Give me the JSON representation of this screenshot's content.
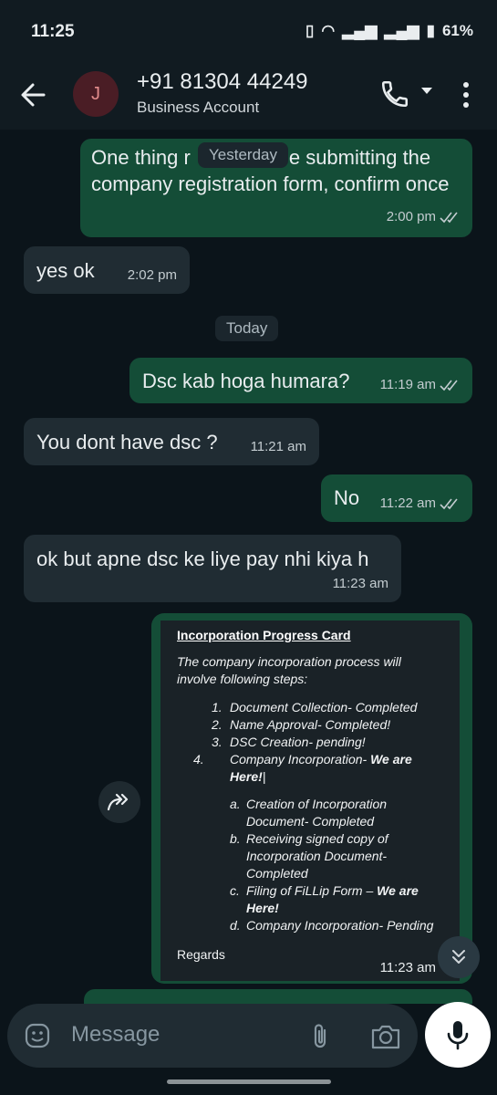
{
  "status_bar": {
    "time": "11:25",
    "battery": "61%"
  },
  "header": {
    "avatar_initial": "J",
    "contact_name": "+91 81304 44249",
    "subtitle": "Business Account"
  },
  "messages": [
    {
      "type": "out",
      "text": "One thing r",
      "text2": "e submitting the company registration form, confirm once",
      "time": "2:00 pm"
    },
    {
      "type": "in",
      "text": "yes ok",
      "time": "2:02 pm"
    },
    {
      "type": "out",
      "text": "Dsc kab hoga humara?",
      "time": "11:19 am"
    },
    {
      "type": "in",
      "text": "You dont have dsc ?",
      "time": "11:21 am"
    },
    {
      "type": "out",
      "text": "No",
      "time": "11:22 am"
    },
    {
      "type": "in",
      "text": "ok but apne dsc ke liye pay nhi kiya h",
      "time": "11:23 am"
    }
  ],
  "date_chips": {
    "yesterday": "Yesterday",
    "today": "Today"
  },
  "progress_card": {
    "title": "Incorporation Progress Card",
    "intro": "The company incorporation process will involve following steps:",
    "steps": [
      {
        "num": "1.",
        "text": "Document Collection- Completed"
      },
      {
        "num": "2.",
        "text": "Name Approval- Completed!"
      },
      {
        "num": "3.",
        "text": "DSC Creation- pending!"
      },
      {
        "num": "4.",
        "text": "Company Incorporation- ",
        "bold": "We are Here!",
        "tail": "|"
      }
    ],
    "substeps": [
      {
        "num": "a.",
        "text": "Creation of Incorporation Document- Completed"
      },
      {
        "num": "b.",
        "text": "Receiving signed copy of Incorporation Document- Completed"
      },
      {
        "num": "c.",
        "text": "Filing of FiLLip Form – ",
        "bold": "We are Here!"
      },
      {
        "num": "d.",
        "text": "Company Incorporation- Pending"
      }
    ],
    "regards": "Regards",
    "time": "11:23 am"
  },
  "composer": {
    "placeholder": "Message"
  },
  "colors": {
    "outgoing": "#144d37",
    "incoming": "#202c33",
    "background": "#0b141a",
    "header": "#111b21"
  },
  "icons": [
    "back-arrow-icon",
    "phone-icon",
    "more-vert-icon",
    "forward-icon",
    "double-chevron-down-icon",
    "emoji-icon",
    "paperclip-icon",
    "camera-icon",
    "mic-icon",
    "read-ticks-icon"
  ]
}
